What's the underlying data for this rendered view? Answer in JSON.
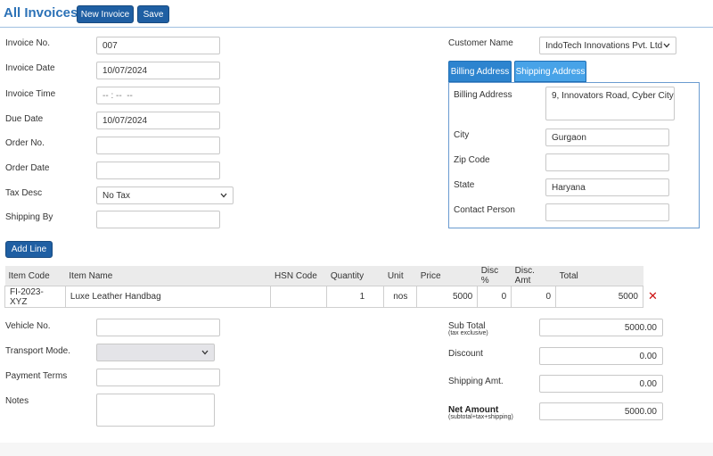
{
  "header": {
    "title": "All Invoices",
    "new_invoice_label": "New Invoice",
    "save_label": "Save"
  },
  "left_form": {
    "invoice_no": {
      "label": "Invoice No.",
      "value": "007"
    },
    "invoice_date": {
      "label": "Invoice Date",
      "value": "10/07/2024"
    },
    "invoice_time": {
      "label": "Invoice Time",
      "value": "-- : --  --"
    },
    "due_date": {
      "label": "Due Date",
      "value": "10/07/2024"
    },
    "order_no": {
      "label": "Order No.",
      "value": ""
    },
    "order_date": {
      "label": "Order Date",
      "value": ""
    },
    "tax_desc": {
      "label": "Tax Desc",
      "value": "No Tax"
    },
    "shipping_by": {
      "label": "Shipping By",
      "value": ""
    }
  },
  "customer": {
    "label": "Customer Name",
    "value": "IndoTech Innovations Pvt. Ltd"
  },
  "address_tabs": {
    "billing_tab": "Billing Address",
    "shipping_tab": "Shipping Address"
  },
  "billing": {
    "address": {
      "label": "Billing Address",
      "value": "9, Innovators Road, Cyber City"
    },
    "city": {
      "label": "City",
      "value": "Gurgaon"
    },
    "zip": {
      "label": "Zip Code",
      "value": ""
    },
    "state": {
      "label": "State",
      "value": "Haryana"
    },
    "contact": {
      "label": "Contact Person",
      "value": ""
    }
  },
  "add_line_label": "Add Line",
  "line_items": {
    "columns": [
      "Item Code",
      "Item Name",
      "HSN Code",
      "Quantity",
      "Unit",
      "Price",
      "Disc %",
      "Disc. Amt",
      "Total"
    ],
    "rows": [
      {
        "item_code": "FI-2023-XYZ",
        "item_name": "Luxe Leather Handbag",
        "hsn": "",
        "quantity": "1",
        "unit": "nos",
        "price": "5000",
        "disc_pct": "0",
        "disc_amt": "0",
        "total": "5000"
      }
    ],
    "delete_glyph": "✕"
  },
  "bottom_left": {
    "vehicle_no": {
      "label": "Vehicle No.",
      "value": ""
    },
    "transport_mode": {
      "label": "Transport Mode.",
      "value": ""
    },
    "payment_terms": {
      "label": "Payment Terms",
      "value": ""
    },
    "notes": {
      "label": "Notes",
      "value": ""
    }
  },
  "totals": {
    "sub_total": {
      "label": "Sub Total",
      "sublabel": "(tax exclusive)",
      "value": "5000.00"
    },
    "discount": {
      "label": "Discount",
      "value": "0.00"
    },
    "shipping_amt": {
      "label": "Shipping Amt.",
      "value": "0.00"
    },
    "net_amount": {
      "label": "Net Amount",
      "sublabel": "(subtotal+tax+shipping)",
      "value": "5000.00"
    }
  },
  "colors": {
    "accent": "#1f5fa3",
    "title": "#2c72b7",
    "tab": "#3a8fd8",
    "delete": "#cc1111"
  },
  "icons": {
    "dropdown": "chevron-down-icon",
    "delete": "close-icon"
  }
}
